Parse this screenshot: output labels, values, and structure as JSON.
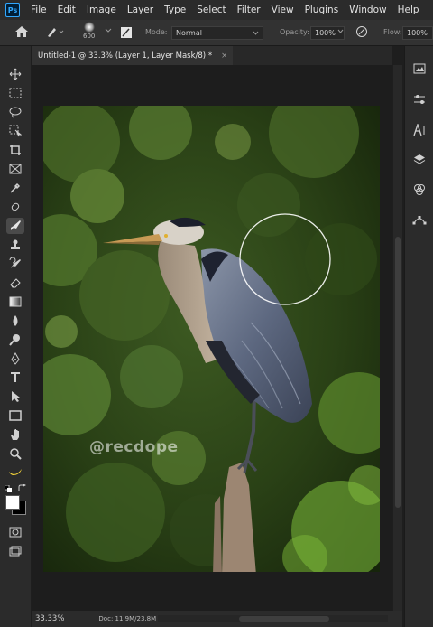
{
  "app": {
    "logo_text": "Ps"
  },
  "menu": [
    "File",
    "Edit",
    "Image",
    "Layer",
    "Type",
    "Select",
    "Filter",
    "View",
    "Plugins",
    "Window",
    "Help"
  ],
  "options": {
    "brush_size": "600",
    "mode_label": "Mode:",
    "mode_value": "Normal",
    "opacity_label": "Opacity:",
    "opacity_value": "100%",
    "flow_label": "Flow:",
    "flow_value": "100%"
  },
  "document": {
    "tab_title": "Untitled-1 @ 33.3% (Layer 1, Layer Mask/8) *",
    "tab_close": "×",
    "watermark": "@recdope"
  },
  "status": {
    "zoom": "33.33%",
    "doc_info": "Doc: 11.9M/23.8M",
    "arrow": ">"
  },
  "toolbar_icons": [
    "move-icon",
    "marquee-icon",
    "lasso-icon",
    "object-select-icon",
    "crop-icon",
    "frame-icon",
    "eyedropper-icon",
    "healing-brush-icon",
    "brush-icon",
    "clone-stamp-icon",
    "history-brush-icon",
    "eraser-icon",
    "gradient-icon",
    "blur-icon",
    "dodge-icon",
    "pen-icon",
    "type-icon",
    "path-select-icon",
    "rectangle-icon",
    "hand-icon",
    "zoom-icon",
    "banana-icon"
  ],
  "colors": {
    "foreground": "#ffffff",
    "background": "#000000",
    "accent": "#31a8ff"
  },
  "right_panel_icons": [
    "image-panel-icon",
    "adjustments-icon",
    "character-icon",
    "layers-icon",
    "channels-icon",
    "paths-icon"
  ]
}
